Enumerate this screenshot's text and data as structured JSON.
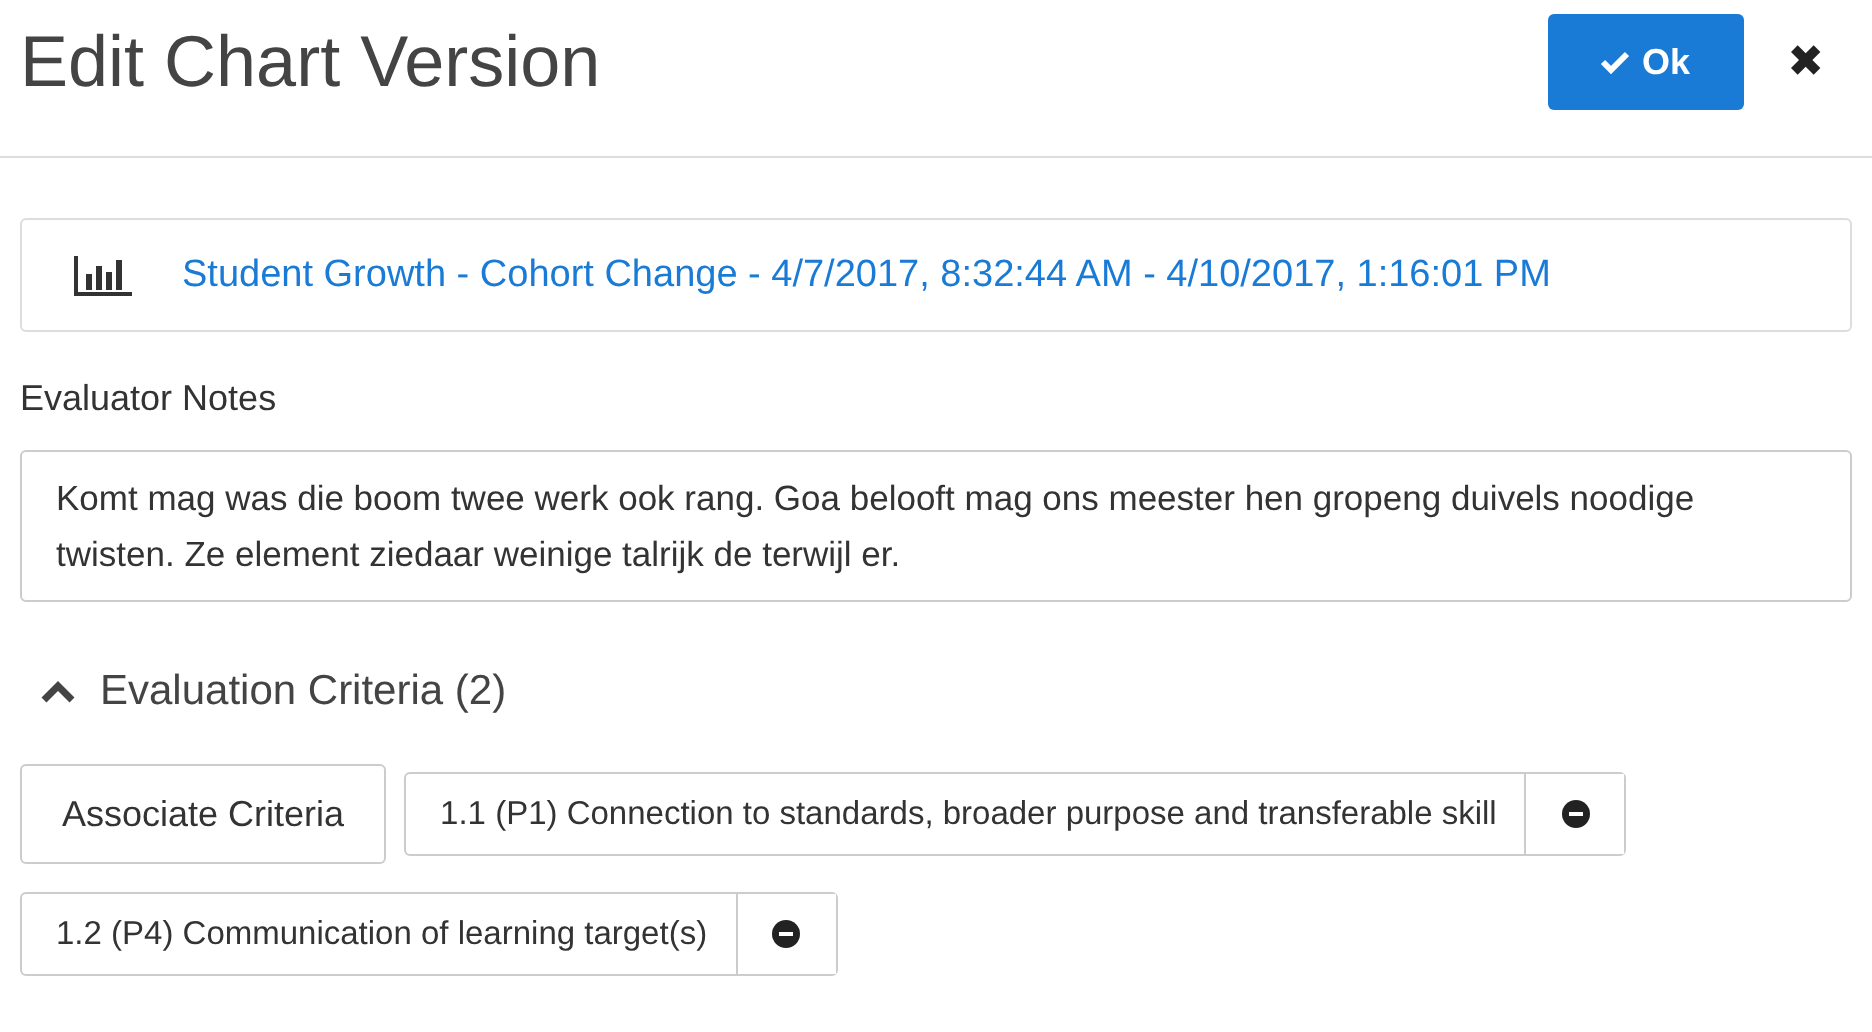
{
  "dialog": {
    "title": "Edit Chart Version",
    "ok_button": "Ok",
    "close_button": "✖"
  },
  "chart_link": {
    "label": "Student Growth - Cohort Change - 4/7/2017, 8:32:44 AM - 4/10/2017, 1:16:01 PM"
  },
  "notes": {
    "label": "Evaluator Notes",
    "value": "Komt mag was die boom twee werk ook rang. Goa belooft mag ons meester hen gropeng duivels noodige twisten. Ze element ziedaar weinige talrijk de terwijl er."
  },
  "criteria": {
    "heading": "Evaluation Criteria (2)",
    "expanded": true,
    "associate_button": "Associate Criteria",
    "items": [
      {
        "label": "1.1 (P1) Connection to standards, broader purpose and transferable skill"
      },
      {
        "label": "1.2 (P4) Communication of learning target(s)"
      }
    ]
  }
}
